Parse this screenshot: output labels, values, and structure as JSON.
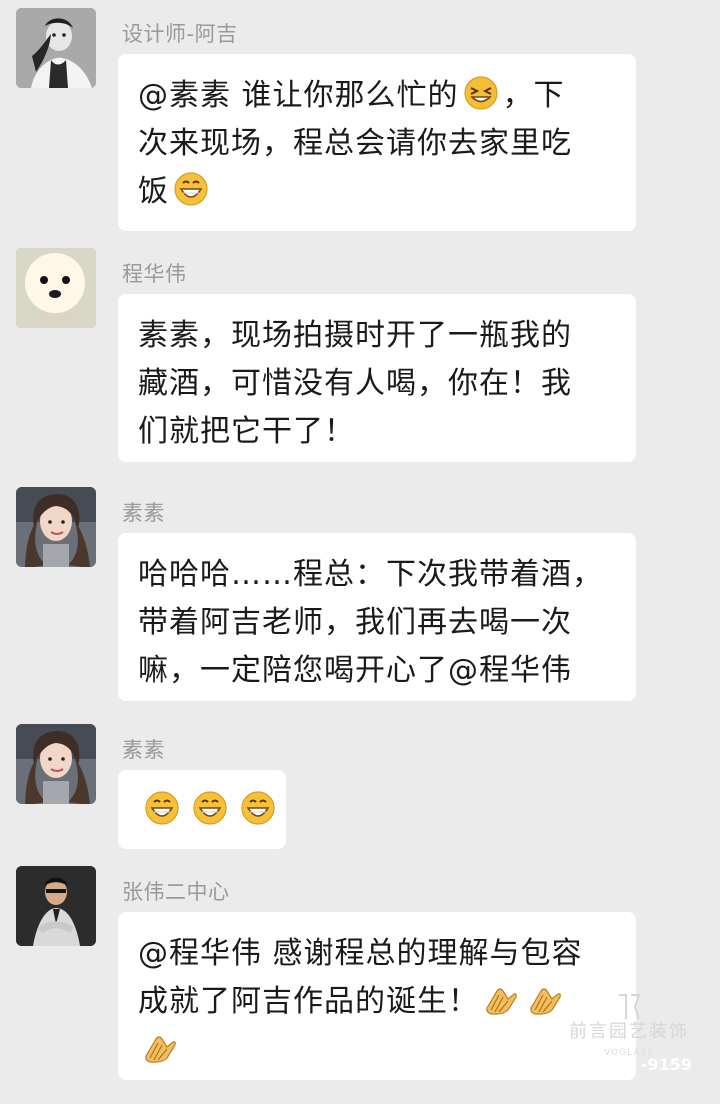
{
  "messages": [
    {
      "sender": "设计师-阿吉",
      "lines": [
        [
          "@素素  谁让你那么忙的",
          "wink-face-icon",
          "，下"
        ],
        [
          "次来现场，程总会请你去家里吃"
        ],
        [
          "饭",
          "grin-face-icon"
        ]
      ]
    },
    {
      "sender": "程华伟",
      "lines": [
        [
          "素素，现场拍摄时开了一瓶我的"
        ],
        [
          "藏酒，可惜没有人喝，你在！我"
        ],
        [
          "们就把它干了！"
        ]
      ]
    },
    {
      "sender": "素素",
      "lines": [
        [
          "哈哈哈……程总：下次我带着酒，"
        ],
        [
          "带着阿吉老师，我们再去喝一次"
        ],
        [
          "嘛，一定陪您喝开心了@程华伟"
        ]
      ]
    },
    {
      "sender": "素素",
      "emojis": [
        "grin-face-icon",
        "grin-face-icon",
        "grin-face-icon"
      ]
    },
    {
      "sender": "张伟二中心",
      "lines": [
        [
          "@程华伟  感谢程总的理解与包容"
        ],
        [
          "成就了阿吉作品的诞生！",
          "clap-hands-icon",
          "clap-hands-icon"
        ],
        [
          "clap-hands-icon"
        ]
      ]
    }
  ],
  "watermark": {
    "name": "前言园艺装饰",
    "brand": "VOGLASS",
    "phone": "-9159"
  },
  "colors": {
    "background": "#ebebeb",
    "bubble": "#ffffff",
    "sender_text": "#9a9a9a",
    "message_text": "#1a1a1a",
    "emoji_face": "#f5c13a"
  }
}
